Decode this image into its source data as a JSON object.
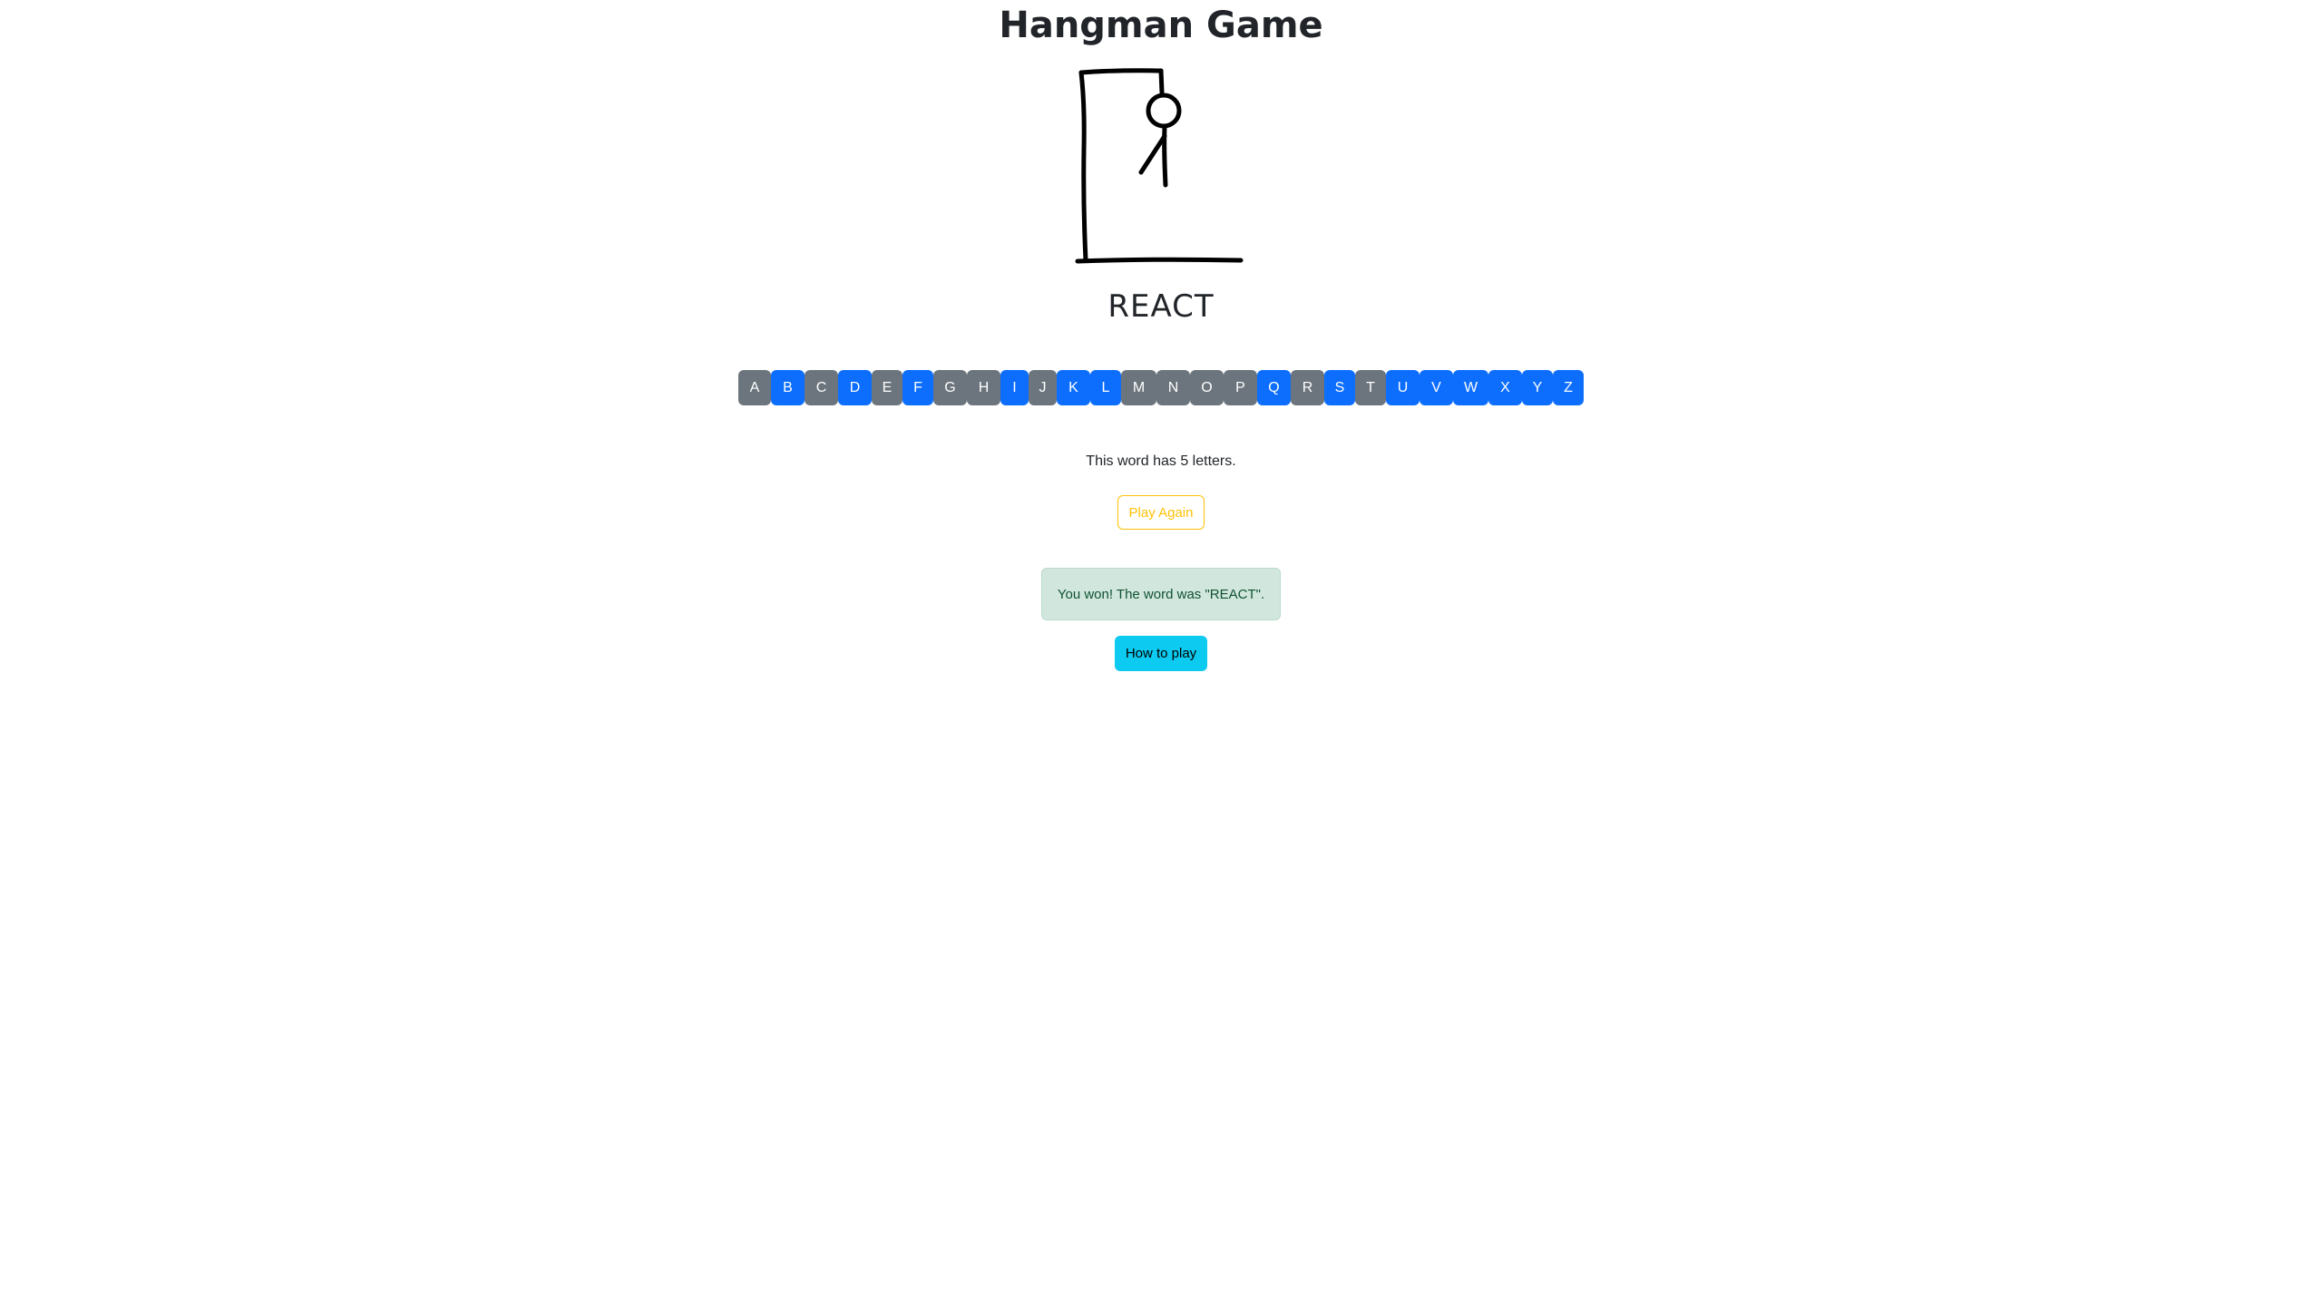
{
  "header": {
    "title": "Hangman Game"
  },
  "game": {
    "word_display": "REACT",
    "parts_drawn": [
      "gallows-base",
      "gallows-post",
      "gallows-beam",
      "rope",
      "head",
      "body",
      "left-arm"
    ],
    "info": "This word has 5 letters.",
    "play_again_label": "Play Again",
    "result_message": "You won! The word was \"REACT\".",
    "how_to_play_label": "How to play"
  },
  "keyboard": {
    "letters": [
      {
        "letter": "A",
        "state": "guessed"
      },
      {
        "letter": "B",
        "state": "available"
      },
      {
        "letter": "C",
        "state": "guessed"
      },
      {
        "letter": "D",
        "state": "available"
      },
      {
        "letter": "E",
        "state": "guessed"
      },
      {
        "letter": "F",
        "state": "available"
      },
      {
        "letter": "G",
        "state": "guessed"
      },
      {
        "letter": "H",
        "state": "guessed"
      },
      {
        "letter": "I",
        "state": "available"
      },
      {
        "letter": "J",
        "state": "guessed"
      },
      {
        "letter": "K",
        "state": "available"
      },
      {
        "letter": "L",
        "state": "available"
      },
      {
        "letter": "M",
        "state": "guessed"
      },
      {
        "letter": "N",
        "state": "guessed"
      },
      {
        "letter": "O",
        "state": "guessed"
      },
      {
        "letter": "P",
        "state": "guessed"
      },
      {
        "letter": "Q",
        "state": "available"
      },
      {
        "letter": "R",
        "state": "guessed"
      },
      {
        "letter": "S",
        "state": "available"
      },
      {
        "letter": "T",
        "state": "guessed"
      },
      {
        "letter": "U",
        "state": "available"
      },
      {
        "letter": "V",
        "state": "available"
      },
      {
        "letter": "W",
        "state": "available"
      },
      {
        "letter": "X",
        "state": "available"
      },
      {
        "letter": "Y",
        "state": "available"
      },
      {
        "letter": "Z",
        "state": "available"
      }
    ]
  },
  "colors": {
    "guessed_key": "#6c757d",
    "available_key": "#0d6efd",
    "warning_outline": "#ffc107",
    "success_bg": "#d1e7dd",
    "info_button": "#0dcaf0"
  }
}
